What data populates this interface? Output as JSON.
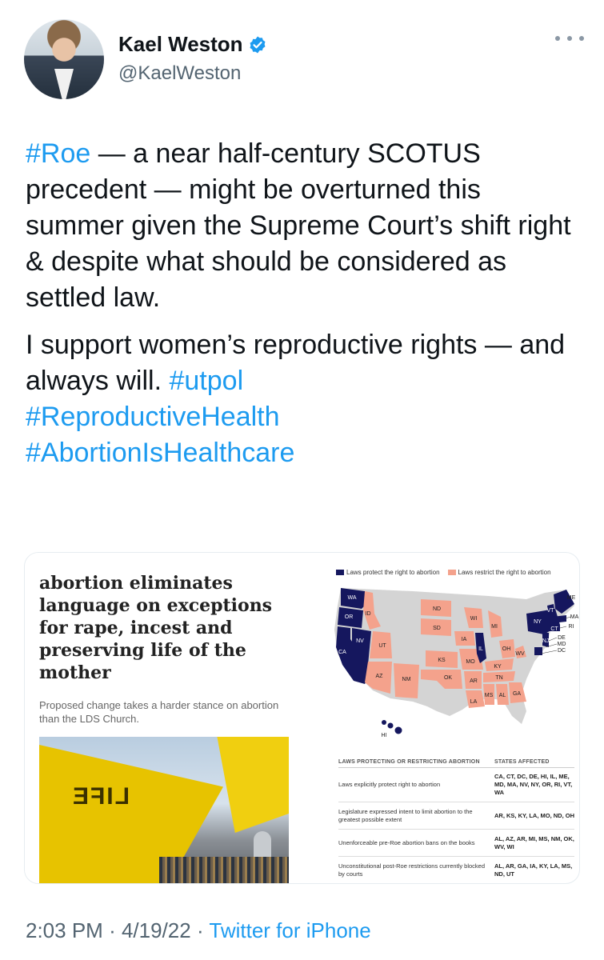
{
  "tweet": {
    "display_name": "Kael Weston",
    "handle": "@KaelWeston",
    "verified_icon": "verified-badge-icon",
    "more_icon": "more-horizontal-icon",
    "paragraph1": {
      "tag": "#Roe",
      "text": " — a near half-century SCOTUS precedent — might be overturned this summer given the Supreme Court’s shift right & despite what should be considered as settled law."
    },
    "paragraph2": {
      "text": "I support women’s reproductive rights — and always will. ",
      "tags": [
        "#utpol",
        "#ReproductiveHealth",
        "#AbortionIsHealthcare"
      ]
    },
    "time": "2:03 PM",
    "date": "4/19/22",
    "separator": "·",
    "source": "Twitter for iPhone"
  },
  "media": {
    "article": {
      "headline": "abortion eliminates language on exceptions for rape, incest and preserving life of the mother",
      "deck": "Proposed change takes a harder stance on abortion than the LDS Church.",
      "banner_text": "LIFE"
    },
    "map": {
      "legend": [
        {
          "label": "Laws protect the right to abortion",
          "color": "#15175e"
        },
        {
          "label": "Laws restrict the right to abortion",
          "color": "#f4a28c"
        }
      ],
      "neutral_color": "#d4d4d4",
      "state_labels": [
        "WA",
        "OR",
        "CA",
        "NV",
        "ID",
        "UT",
        "AZ",
        "NM",
        "ND",
        "SD",
        "KS",
        "OK",
        "IA",
        "MO",
        "AR",
        "LA",
        "WI",
        "IL",
        "MI",
        "OH",
        "KY",
        "TN",
        "MS",
        "AL",
        "GA",
        "WV",
        "VT",
        "ME",
        "NY",
        "MA",
        "RI",
        "CT",
        "NJ",
        "DE",
        "MD",
        "DC",
        "HI"
      ]
    },
    "table": {
      "headers": [
        "LAWS PROTECTING OR RESTRICTING ABORTION",
        "STATES AFFECTED"
      ],
      "rows": [
        {
          "law": "Laws explicitly protect right to abortion",
          "states": "CA, CT, DC, DE, HI, IL, ME, MD, MA, NV, NY, OR, RI, VT, WA"
        },
        {
          "law": "Legislature expressed intent to limit abortion to the greatest possible extent",
          "states": "AR, KS, KY, LA, MO, ND, OH"
        },
        {
          "law": "Unenforceable pre-Roe abortion bans on the books",
          "states": "AL, AZ, AR, MI, MS, NM, OK, WV, WI"
        },
        {
          "law": "Unconstitutional post-Roe restrictions currently blocked by courts",
          "states": "AL, AR, GA, IA, KY, LA, MS, ND, UT"
        }
      ]
    }
  }
}
